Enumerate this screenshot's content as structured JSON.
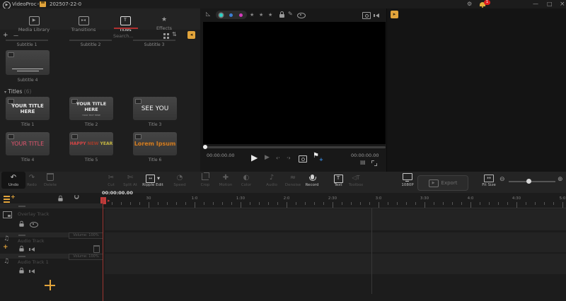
{
  "titlebar": {
    "app_name": "VideoProc",
    "app_caret": "∨",
    "project_name": "202507-22-0",
    "notification_count": "1"
  },
  "colors": {
    "accent_yellow": "#e2a43b",
    "tab_underline_red": "#b03030",
    "playhead_red": "#c23b3b",
    "notification_red": "#e02020",
    "dot_cyan": "#2ad4c8",
    "dot_blue": "#3b7fd4",
    "dot_magenta": "#d43bbb",
    "marker_blue": "#3b8fe8"
  },
  "glyphs": {
    "logo": "▶",
    "minimize": "—",
    "maximize": "□",
    "close": "×",
    "gear": "⚙",
    "tab_media": "▶",
    "tab_transitions": "▸◂",
    "tab_titles": "T",
    "tab_effects": "★",
    "add": "+",
    "remove": "—",
    "sort": "⇅",
    "panel_toggle_left": "◂",
    "panel_toggle_right": "▸",
    "ruler": "◺",
    "star": "★",
    "brush": "✎",
    "play": "▶",
    "play2": "▶",
    "prev_frame": "‹·",
    "next_frame": "·›",
    "marker_flag": "⚑",
    "marker_plus": "+",
    "grid_small": "▤",
    "undo": "↶",
    "redo": "↷",
    "cut": "✂",
    "split": "✄",
    "ripple": "↔",
    "ripple_caret": "▼",
    "speed": "◔",
    "motion": "✚",
    "color": "◐",
    "audio": "♪",
    "denoise": "≈",
    "toolbox": "◁T",
    "text_plus": "T",
    "export_play": "▶",
    "fit_arrows": "↔",
    "zoom_out": "⊖",
    "zoom_in": "⊕",
    "magnet": "C",
    "section_caret": "▾",
    "titles_cut_note": ""
  },
  "tabs": {
    "media_library": "Media Library",
    "transitions": "Transitions",
    "titles": "Titles",
    "effects": "Effects"
  },
  "library_toolbar": {
    "search_placeholder": "Search..."
  },
  "subtitles": {
    "labels": [
      "Subtitle 1",
      "Subtitle 2",
      "Subtitle 3",
      "Subtitle 4"
    ]
  },
  "titles_section": {
    "title": "Titles",
    "count": "(6)",
    "items": [
      {
        "label": "Title 1",
        "preview": "YOUR TITLE HERE"
      },
      {
        "label": "Title 2",
        "preview": "YOUR TITLE HERE",
        "preview_sub": "YOUR TEXT HERE"
      },
      {
        "label": "Title 3",
        "preview": "SEE YOU"
      },
      {
        "label": "Title 4",
        "preview": "YOUR TITLE"
      },
      {
        "label": "Title 5",
        "preview_parts": [
          "HAPPY",
          "NEW",
          "YEAR"
        ]
      },
      {
        "label": "Title 6",
        "preview": "Lorem Ipsum"
      }
    ]
  },
  "preview": {
    "current_time": "00:00:00.00",
    "duration": "00:00:00.00"
  },
  "toolbar": {
    "items": [
      {
        "label": "Undo",
        "enabled": true
      },
      {
        "label": "Redo",
        "enabled": false
      },
      {
        "label": "Delete",
        "enabled": false
      },
      {
        "label": "Cut",
        "enabled": false
      },
      {
        "label": "Split At",
        "enabled": false
      },
      {
        "label": "Ripple Edit",
        "enabled": true
      },
      {
        "label": "Speed",
        "enabled": false
      },
      {
        "label": "Crop",
        "enabled": false
      },
      {
        "label": "Motion",
        "enabled": false
      },
      {
        "label": "Color",
        "enabled": false
      },
      {
        "label": "Audio",
        "enabled": false
      },
      {
        "label": "Denoise",
        "enabled": false
      },
      {
        "label": "Record",
        "enabled": true
      },
      {
        "label": "Text",
        "enabled": true
      },
      {
        "label": "Toolbox",
        "enabled": false
      }
    ],
    "resolution": "1080P",
    "export_label": "Export",
    "fit_label": "Fit Size"
  },
  "timeline": {
    "playhead_time": "00:00:00.00",
    "ruler_labels": [
      "30",
      "1:0",
      "1:30",
      "2:0",
      "2:30",
      "3:0",
      "3:30",
      "4:0",
      "4:30",
      "5:0"
    ],
    "tracks": {
      "overlay": {
        "name": "Overlay Track"
      },
      "audio1": {
        "name": "Audio Track",
        "volume": "Volume: 100%"
      },
      "audio2": {
        "name": "Audio Track 1",
        "volume": "Volume: 100%"
      }
    }
  }
}
